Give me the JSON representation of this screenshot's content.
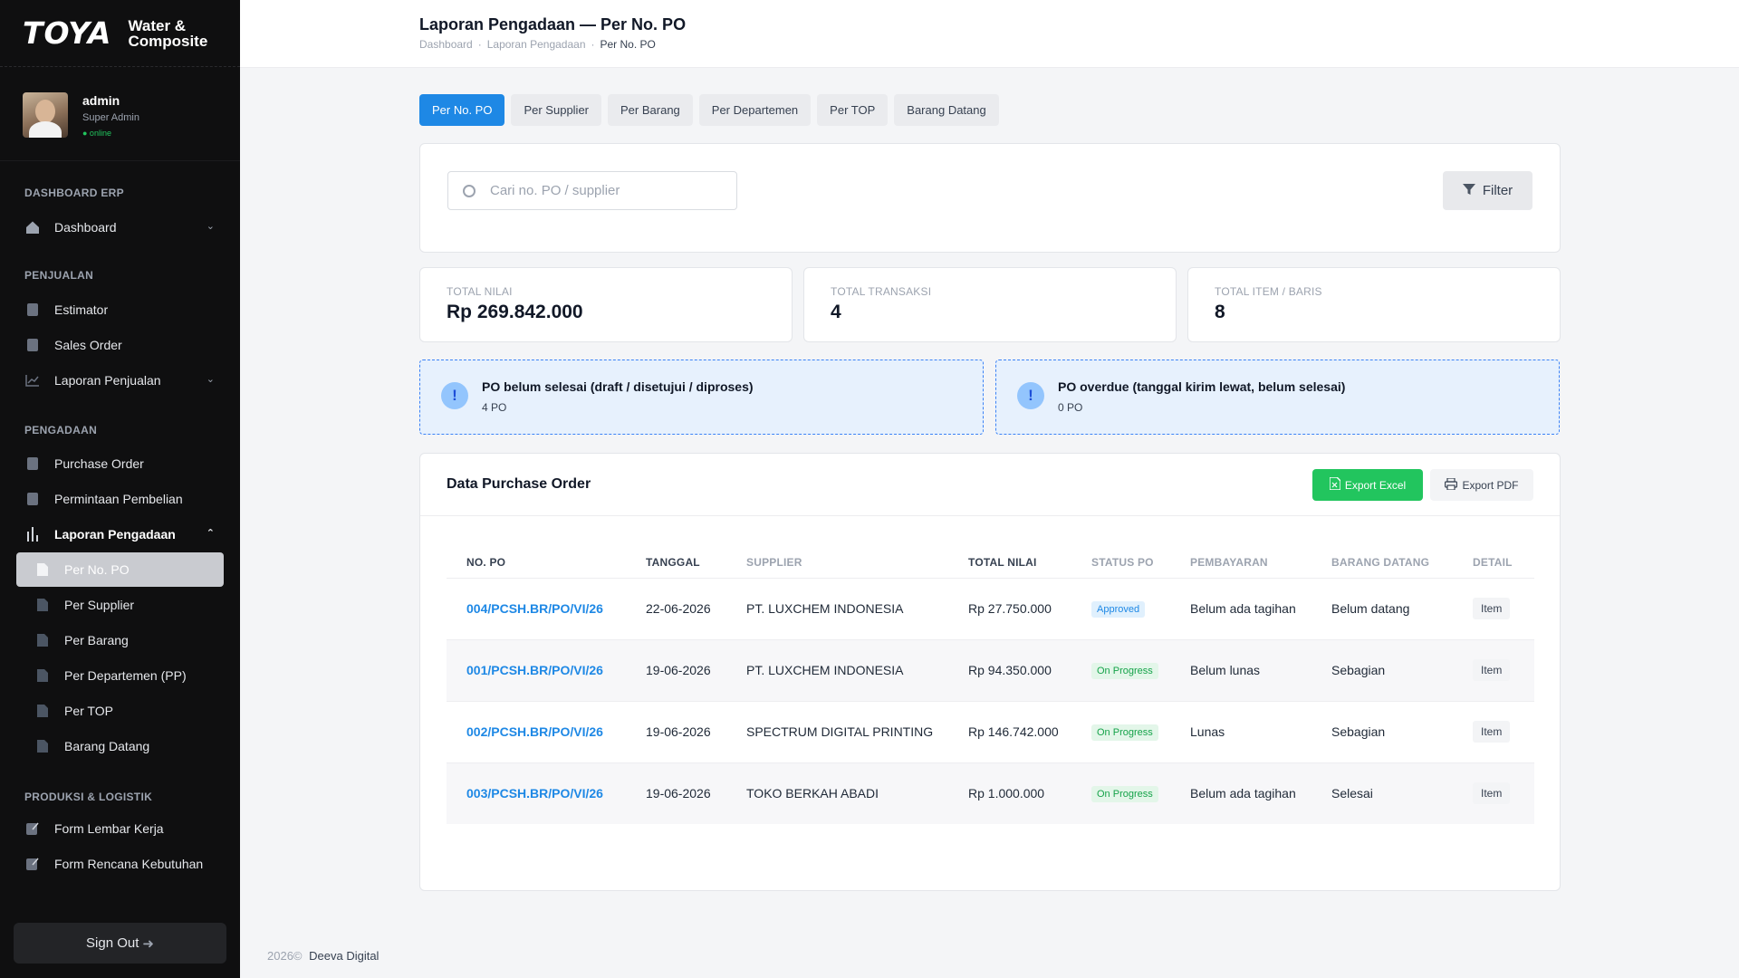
{
  "brand": {
    "logo": "TOYA",
    "sub1": "Water &",
    "sub2": "Composite"
  },
  "user": {
    "name": "admin",
    "role": "Super Admin",
    "status": "● online"
  },
  "nav": {
    "sections": [
      "DASHBOARD ERP",
      "PENJUALAN",
      "PENGADAAN",
      "PRODUKSI & LOGISTIK"
    ],
    "items": [
      {
        "label": "Dashboard",
        "icon": "home-icon",
        "chevron": "down"
      },
      {
        "label": "Estimator",
        "icon": "doc-icon"
      },
      {
        "label": "Sales Order",
        "icon": "doc-icon"
      },
      {
        "label": "Laporan Penjualan",
        "icon": "chart-line-icon",
        "chevron": "down"
      },
      {
        "label": "Purchase Order",
        "icon": "doc-icon"
      },
      {
        "label": "Permintaan Pembelian",
        "icon": "doc-icon"
      },
      {
        "label": "Laporan Pengadaan",
        "icon": "bar-chart-icon",
        "chevron": "up"
      },
      {
        "label": "Per No. PO",
        "icon": "file-icon",
        "active": true
      },
      {
        "label": "Per Supplier",
        "icon": "file-icon"
      },
      {
        "label": "Per Barang",
        "icon": "file-icon"
      },
      {
        "label": "Per Departemen (PP)",
        "icon": "file-icon"
      },
      {
        "label": "Per TOP",
        "icon": "file-icon"
      },
      {
        "label": "Barang Datang",
        "icon": "file-icon"
      },
      {
        "label": "Form Lembar Kerja",
        "icon": "edit-icon"
      },
      {
        "label": "Form Rencana Kebutuhan",
        "icon": "edit-icon"
      }
    ],
    "signout": "Sign Out"
  },
  "header": {
    "title": "Laporan Pengadaan — Per No. PO",
    "breadcrumb": [
      "Dashboard",
      "Laporan Pengadaan",
      "Per No. PO"
    ]
  },
  "tabs": [
    "Per No. PO",
    "Per Supplier",
    "Per Barang",
    "Per Departemen",
    "Per TOP",
    "Barang Datang"
  ],
  "search": {
    "placeholder": "Cari no. PO / supplier",
    "filter_label": "Filter"
  },
  "stats": [
    {
      "label": "TOTAL NILAI",
      "value": "Rp 269.842.000"
    },
    {
      "label": "TOTAL TRANSAKSI",
      "value": "4"
    },
    {
      "label": "TOTAL ITEM / BARIS",
      "value": "8"
    }
  ],
  "alerts": [
    {
      "title": "PO belum selesai (draft / disetujui / diproses)",
      "sub": "4 PO"
    },
    {
      "title": "PO overdue (tanggal kirim lewat, belum selesai)",
      "sub": "0 PO"
    }
  ],
  "table": {
    "title": "Data Purchase Order",
    "export_excel": "Export Excel",
    "export_pdf": "Export PDF",
    "columns": [
      "NO. PO",
      "TANGGAL",
      "SUPPLIER",
      "TOTAL NILAI",
      "STATUS PO",
      "PEMBAYARAN",
      "BARANG DATANG",
      "DETAIL"
    ],
    "rows": [
      {
        "no_po": "004/PCSH.BR/PO/VI/26",
        "tanggal": "22-06-2026",
        "supplier": "PT. LUXCHEM INDONESIA",
        "total": "Rp 27.750.000",
        "status": "Approved",
        "status_type": "approved",
        "pembayaran": "Belum ada tagihan",
        "datang": "Belum datang",
        "detail": "Item"
      },
      {
        "no_po": "001/PCSH.BR/PO/VI/26",
        "tanggal": "19-06-2026",
        "supplier": "PT. LUXCHEM INDONESIA",
        "total": "Rp 94.350.000",
        "status": "On Progress",
        "status_type": "progress",
        "pembayaran": "Belum lunas",
        "datang": "Sebagian",
        "detail": "Item"
      },
      {
        "no_po": "002/PCSH.BR/PO/VI/26",
        "tanggal": "19-06-2026",
        "supplier": "SPECTRUM DIGITAL PRINTING",
        "total": "Rp 146.742.000",
        "status": "On Progress",
        "status_type": "progress",
        "pembayaran": "Lunas",
        "datang": "Sebagian",
        "detail": "Item"
      },
      {
        "no_po": "003/PCSH.BR/PO/VI/26",
        "tanggal": "19-06-2026",
        "supplier": "TOKO BERKAH ABADI",
        "total": "Rp 1.000.000",
        "status": "On Progress",
        "status_type": "progress",
        "pembayaran": "Belum ada tagihan",
        "datang": "Selesai",
        "detail": "Item"
      }
    ]
  },
  "footer": {
    "year": "2026©",
    "company": "Deeva Digital"
  },
  "colors": {
    "accent": "#1e88e5",
    "success": "#22c55e",
    "sidebar": "#0f0f10"
  }
}
